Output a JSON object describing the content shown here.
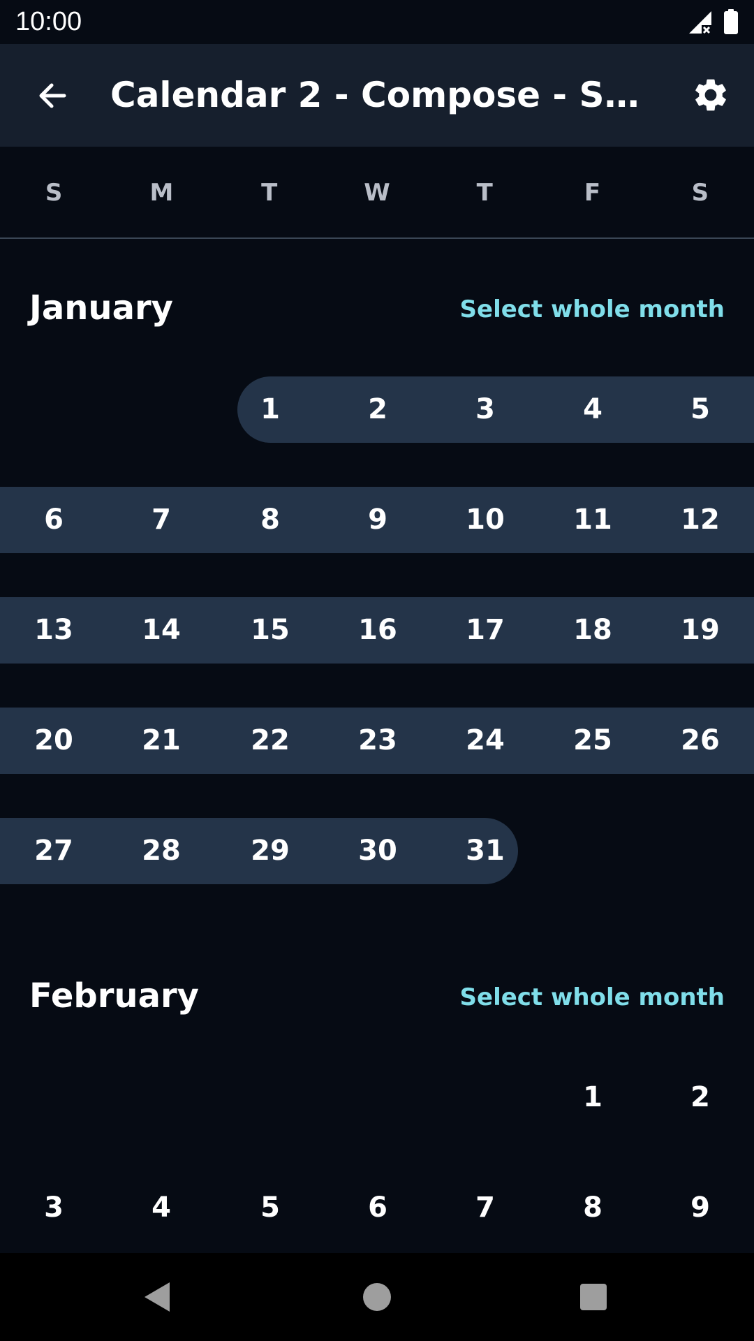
{
  "status_bar": {
    "time": "10:00"
  },
  "app_bar": {
    "title": "Calendar 2 - Compose - Selec..."
  },
  "weekdays": [
    "S",
    "M",
    "T",
    "W",
    "T",
    "F",
    "S"
  ],
  "months": [
    {
      "name": "January",
      "select_label": "Select whole month",
      "weeks": [
        [
          "",
          "",
          "1",
          "2",
          "3",
          "4",
          "5"
        ],
        [
          "6",
          "7",
          "8",
          "9",
          "10",
          "11",
          "12"
        ],
        [
          "13",
          "14",
          "15",
          "16",
          "17",
          "18",
          "19"
        ],
        [
          "20",
          "21",
          "22",
          "23",
          "24",
          "25",
          "26"
        ],
        [
          "27",
          "28",
          "29",
          "30",
          "31",
          "",
          ""
        ]
      ],
      "selected_range": {
        "start": "1",
        "end": "31"
      }
    },
    {
      "name": "February",
      "select_label": "Select whole month",
      "weeks": [
        [
          "",
          "",
          "",
          "",
          "",
          "1",
          "2"
        ],
        [
          "3",
          "4",
          "5",
          "6",
          "7",
          "8",
          "9"
        ]
      ],
      "selected_range": null
    }
  ],
  "colors": {
    "background": "#060b14",
    "app_bar": "#161f2d",
    "range_band": "#243449",
    "accent": "#80deea",
    "weekday_text": "#b9bec8"
  },
  "icons": {
    "back": "arrow-back-icon",
    "settings": "gear-icon",
    "signal": "signal-off-icon",
    "battery": "battery-icon",
    "nav_back": "nav-back-icon",
    "nav_home": "nav-home-icon",
    "nav_recents": "nav-recents-icon"
  }
}
